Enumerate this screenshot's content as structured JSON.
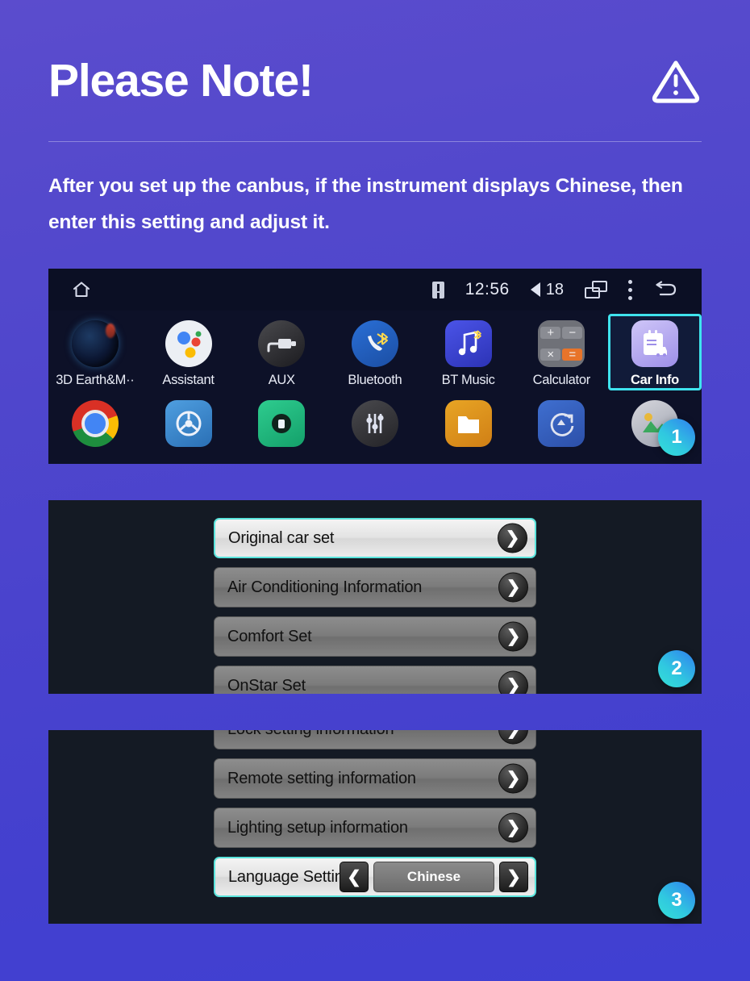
{
  "header": {
    "title": "Please Note!",
    "warning_icon": "warning-triangle-icon"
  },
  "body_text": "After you set up the canbus, if the instrument displays Chinese, then enter this setting and adjust it.",
  "colors": {
    "background_top": "#5b4ccd",
    "background_bottom": "#4040d2",
    "accent_cyan": "#3fe3ee",
    "badge_gradient_start": "#35e0d6",
    "badge_gradient_end": "#2f7ff0",
    "panel_dark": "#141a24"
  },
  "screenshot_launcher": {
    "statusbar": {
      "home_icon": "home-icon",
      "warning_icon": "warning-square-icon",
      "clock": "12:56",
      "volume_icon": "speaker-icon",
      "volume": "18",
      "recents_icon": "recents-icon",
      "menu_icon": "more-vertical-icon",
      "back_icon": "back-arrow-icon"
    },
    "apps_row1": [
      {
        "label": "3D Earth&M··",
        "icon": "earth-icon",
        "selected": false
      },
      {
        "label": "Assistant",
        "icon": "assistant-icon",
        "selected": false
      },
      {
        "label": "AUX",
        "icon": "aux-plug-icon",
        "selected": false
      },
      {
        "label": "Bluetooth",
        "icon": "bluetooth-phone-icon",
        "selected": false
      },
      {
        "label": "BT Music",
        "icon": "bt-music-icon",
        "selected": false
      },
      {
        "label": "Calculator",
        "icon": "calculator-icon",
        "selected": false
      },
      {
        "label": "Car Info",
        "icon": "car-info-icon",
        "selected": true
      }
    ],
    "calculator_keys": [
      "+",
      "−",
      "×",
      "="
    ],
    "apps_row2": [
      {
        "icon": "chrome-icon"
      },
      {
        "icon": "steering-wheel-icon"
      },
      {
        "icon": "recorder-icon"
      },
      {
        "icon": "equalizer-icon"
      },
      {
        "icon": "file-manager-icon"
      },
      {
        "icon": "sync-update-icon"
      },
      {
        "icon": "gallery-icon"
      }
    ]
  },
  "screenshot_carinfo": {
    "items": [
      {
        "label": "Original car set",
        "highlight": true
      },
      {
        "label": "Air Conditioning Information",
        "highlight": false
      },
      {
        "label": "Comfort Set",
        "highlight": false
      },
      {
        "label": "OnStar Set",
        "highlight": false
      }
    ],
    "chevron": "❯"
  },
  "screenshot_language": {
    "items": [
      {
        "label": "Lock setting information",
        "highlight": false,
        "type": "chevron"
      },
      {
        "label": "Remote setting information",
        "highlight": false,
        "type": "chevron"
      },
      {
        "label": "Lighting setup information",
        "highlight": false,
        "type": "chevron"
      },
      {
        "label": "Language Settings",
        "highlight": true,
        "type": "stepper",
        "value": "Chinese"
      }
    ],
    "chevron": "❯",
    "prev_arrow": "❮",
    "next_arrow": "❯"
  },
  "badges": [
    {
      "number": "1"
    },
    {
      "number": "2"
    },
    {
      "number": "3"
    }
  ]
}
